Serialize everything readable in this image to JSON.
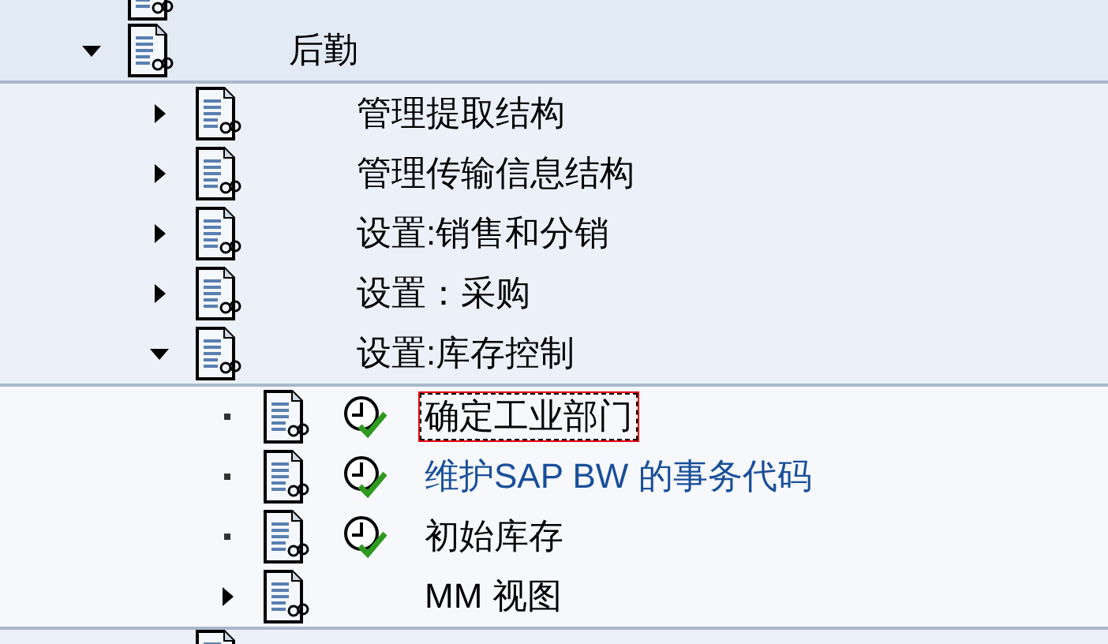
{
  "tree": [
    {
      "kind": "node",
      "label": "后勤",
      "expanded": true,
      "selected": false,
      "link": false,
      "children": [
        {
          "kind": "node",
          "label": "管理提取结构",
          "expanded": false,
          "selected": false,
          "link": false
        },
        {
          "kind": "node",
          "label": "管理传输信息结构",
          "expanded": false,
          "selected": false,
          "link": false
        },
        {
          "kind": "node",
          "label": "设置:销售和分销",
          "expanded": false,
          "selected": false,
          "link": false
        },
        {
          "kind": "node",
          "label": "设置：采购",
          "expanded": false,
          "selected": false,
          "link": false
        },
        {
          "kind": "node",
          "label": "设置:库存控制",
          "expanded": true,
          "selected": false,
          "link": false,
          "children": [
            {
              "kind": "activity",
              "label": "确定工业部门",
              "selected": true,
              "link": false
            },
            {
              "kind": "activity",
              "label": "维护SAP BW 的事务代码",
              "selected": false,
              "link": true
            },
            {
              "kind": "activity",
              "label": "初始库存",
              "selected": false,
              "link": false
            },
            {
              "kind": "node",
              "label": "MM 视图",
              "expanded": false,
              "selected": false,
              "link": false
            }
          ]
        }
      ]
    }
  ]
}
